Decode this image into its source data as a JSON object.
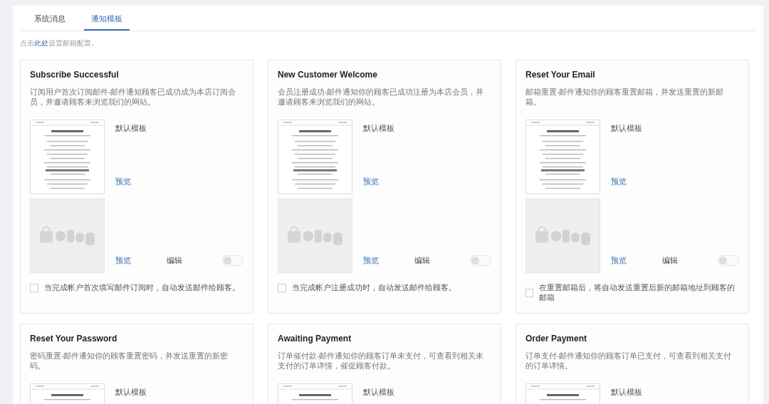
{
  "tabs": [
    {
      "label": "系统消息",
      "selected": false
    },
    {
      "label": "通知模板",
      "selected": true
    }
  ],
  "hint": {
    "before": "点击",
    "link": "此处",
    "after": "设置邮箱配置。"
  },
  "cards": [
    {
      "title": "Subscribe Successful",
      "description": "订阅用户首次订阅邮件-邮件通知顾客已成功成为本店订阅会员，并邀请顾客来浏览我们的网站。",
      "template_label": "默认模板",
      "preview_link": "预览",
      "custom": {
        "preview_link": "预览",
        "edit_label": "编辑",
        "on": false
      },
      "auto_send": {
        "label": "当完成帐户首次填写邮件订阅时，自动发送邮件给顾客。",
        "checked": false
      }
    },
    {
      "title": "New Customer Welcome",
      "description": "会员注册成功-邮件通知你的顾客已成功注册为本店会员，并邀请顾客来浏览我们的网站。",
      "template_label": "默认模板",
      "preview_link": "预览",
      "custom": {
        "preview_link": "预览",
        "edit_label": "编辑",
        "on": false
      },
      "auto_send": {
        "label": "当完成帐户注册成功时，自动发送邮件给顾客。",
        "checked": false
      }
    },
    {
      "title": "Reset Your Email",
      "description": "邮箱重置-邮件通知你的顾客重置邮箱，并发送重置的新邮箱。",
      "template_label": "默认模板",
      "preview_link": "预览",
      "custom": {
        "preview_link": "预览",
        "edit_label": "编辑",
        "on": false
      },
      "auto_send": {
        "label": "在重置邮箱后，将自动发送重置后新的邮箱地址到顾客的邮箱",
        "checked": false
      }
    },
    {
      "title": "Reset Your Password",
      "description": "密码重置-邮件通知你的顾客重置密码，并发送重置的新密码。",
      "template_label": "默认模板"
    },
    {
      "title": "Awaiting Payment",
      "description": "订单催付款-邮件通知你的顾客订单未支付，可查看到相关未支付的订单详情，催促顾客付款。",
      "template_label": "默认模板"
    },
    {
      "title": "Order Payment",
      "description": "订单支付-邮件通知你的顾客订单已支付，可查看到相关支付的订单详情。",
      "template_label": "默认模板"
    }
  ]
}
